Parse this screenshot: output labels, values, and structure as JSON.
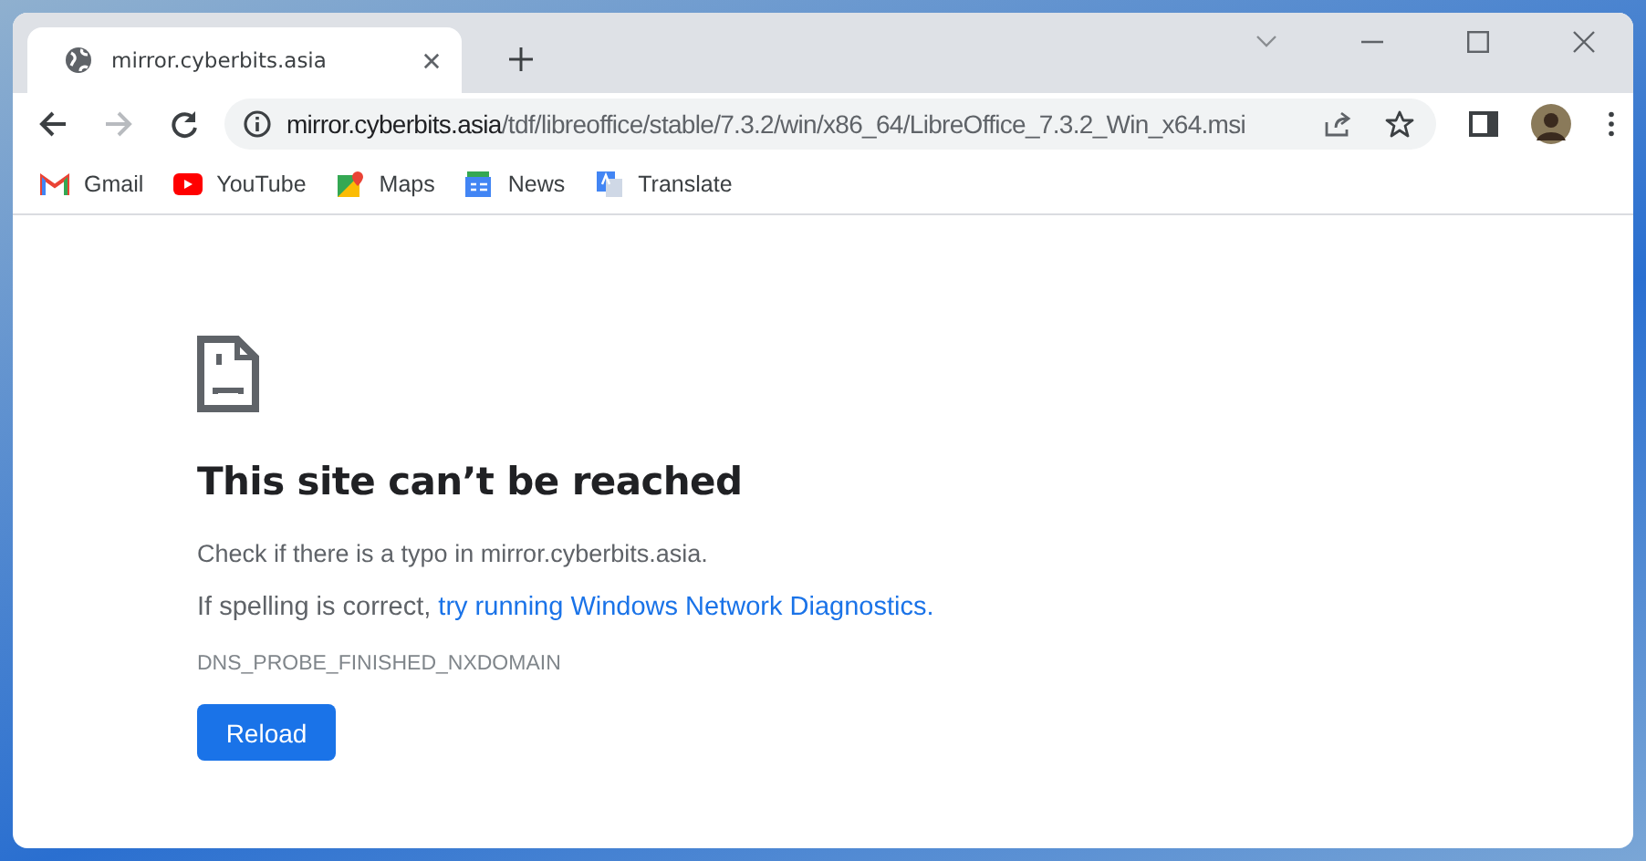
{
  "tabs": [
    {
      "title": "mirror.cyberbits.asia",
      "selected": true
    }
  ],
  "address": {
    "host": "mirror.cyberbits.asia",
    "path": "/tdf/libreoffice/stable/7.3.2/win/x86_64/LibreOffice_7.3.2_Win_x64.msi"
  },
  "bookmarks": [
    {
      "label": "Gmail",
      "kind": "gmail"
    },
    {
      "label": "YouTube",
      "kind": "youtube"
    },
    {
      "label": "Maps",
      "kind": "maps"
    },
    {
      "label": "News",
      "kind": "news"
    },
    {
      "label": "Translate",
      "kind": "translate"
    }
  ],
  "error": {
    "heading": "This site can’t be reached",
    "line_1": "Check if there is a typo in mirror.cyberbits.asia.",
    "line_2": "If spelling is correct, ",
    "link": "try running Windows Network Diagnostics.",
    "code": "DNS_PROBE_FINISHED_NXDOMAIN",
    "button": "Reload"
  }
}
